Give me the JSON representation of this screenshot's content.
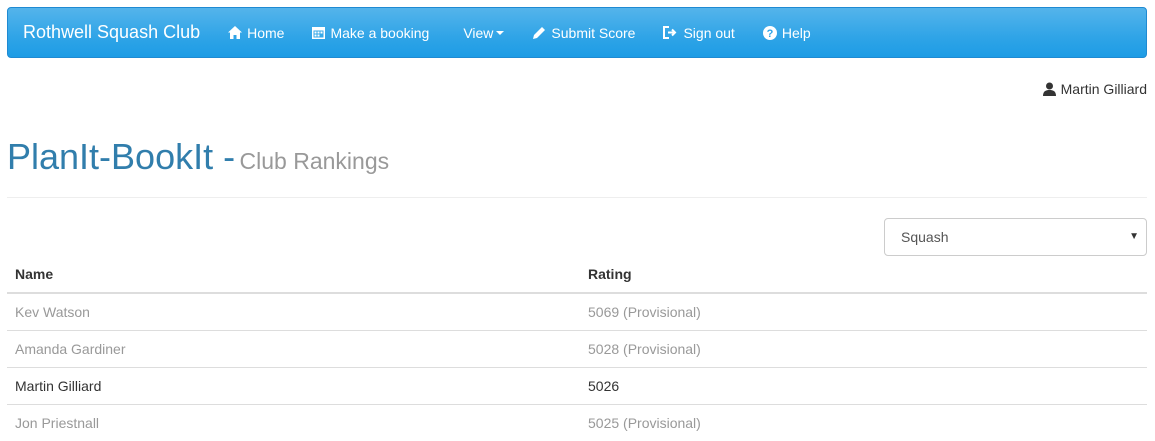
{
  "navbar": {
    "brand": "Rothwell Squash Club",
    "items": [
      {
        "label": "Home",
        "icon": "home-icon"
      },
      {
        "label": "Make a booking",
        "icon": "calendar-icon"
      },
      {
        "label": "View",
        "icon": "caret-down-icon"
      },
      {
        "label": "Submit Score",
        "icon": "pencil-icon"
      },
      {
        "label": "Sign out",
        "icon": "sign-out-icon"
      },
      {
        "label": "Help",
        "icon": "help-icon"
      }
    ]
  },
  "user": {
    "name": "Martin Gilliard",
    "icon": "user-icon"
  },
  "page": {
    "title": "PlanIt-BookIt -",
    "subtitle": "Club Rankings"
  },
  "sport_select": {
    "selected": "Squash"
  },
  "table": {
    "headers": [
      "Name",
      "Rating"
    ],
    "rows": [
      {
        "name": "Kev Watson",
        "rating": "5069 (Provisional)"
      },
      {
        "name": "Amanda Gardiner",
        "rating": "5028 (Provisional)"
      },
      {
        "name": "Martin Gilliard",
        "rating": "5026"
      },
      {
        "name": "Jon Priestnall",
        "rating": "5025 (Provisional)"
      }
    ]
  }
}
